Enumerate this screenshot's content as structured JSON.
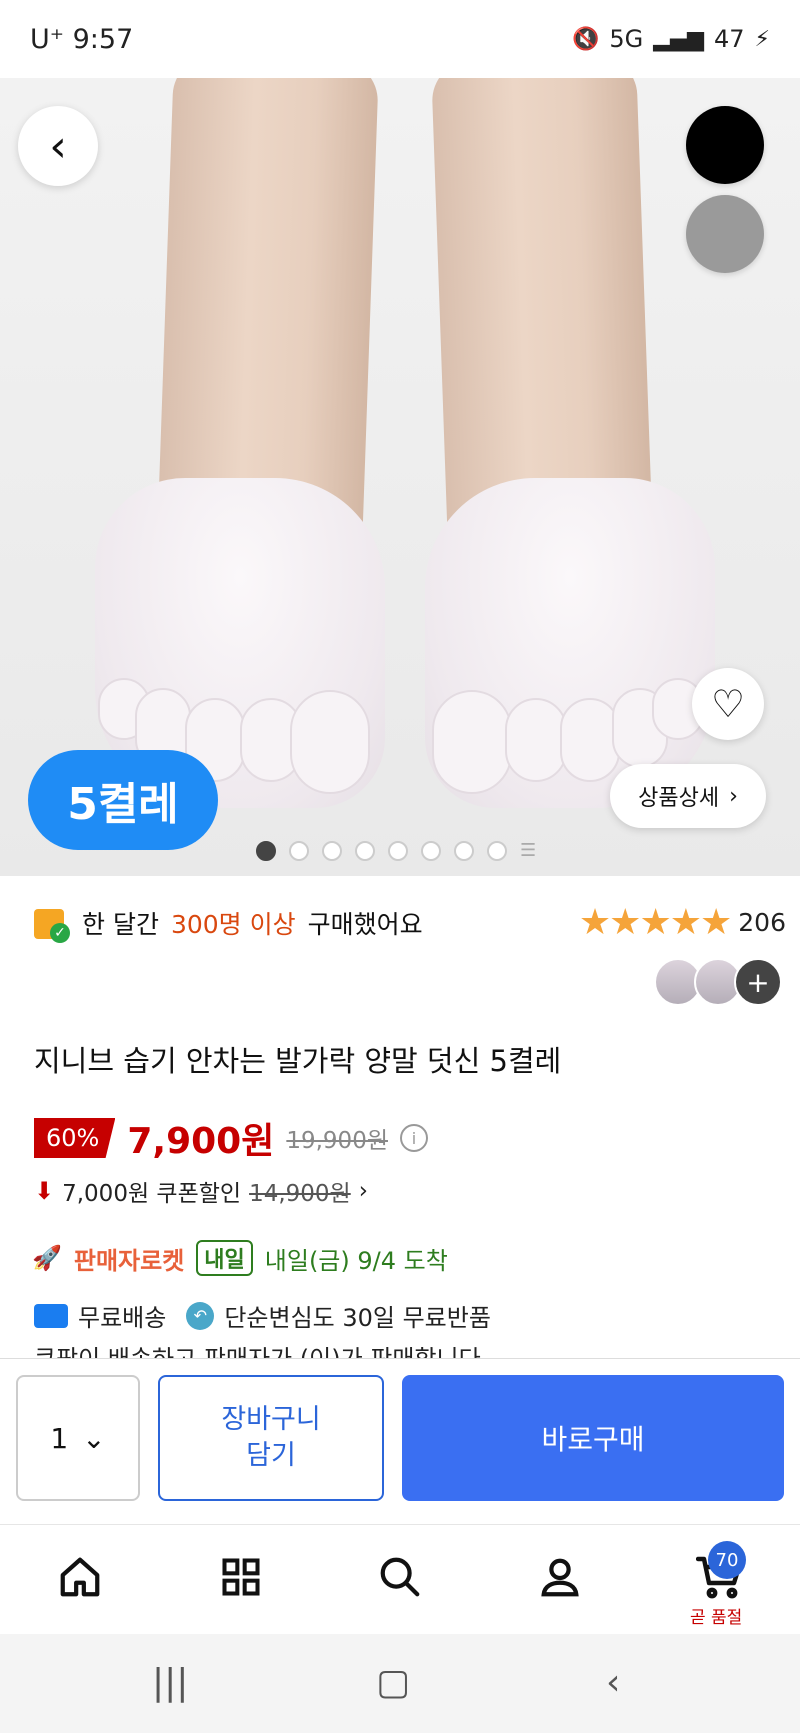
{
  "status_bar": {
    "carrier": "U⁺",
    "time": "9:57",
    "network": "5G",
    "battery": "47"
  },
  "hero": {
    "pack_label": "5켤레",
    "detail_label": "상품상세",
    "image_count": 8,
    "current_image": 1,
    "color_options": [
      {
        "name": "black",
        "color": "#000000"
      },
      {
        "name": "gray",
        "color": "#9a9a9a"
      }
    ]
  },
  "social_proof": {
    "prefix": "한 달간",
    "highlight": "300명 이상",
    "suffix": "구매했어요"
  },
  "rating": {
    "stars": 5,
    "count": "206"
  },
  "product": {
    "title": "지니브 습기 안차는 발가락 양말 덧신 5켤레"
  },
  "price": {
    "discount": "60%",
    "sale": "7,900원",
    "original": "19,900원",
    "coupon_text": "7,000원 쿠폰할인",
    "coupon_original": "14,900원"
  },
  "delivery": {
    "rocket_label": "판매자로켓",
    "tomorrow_badge": "내일",
    "arrival": "내일(금) 9/4 도착",
    "free_shipping": "무료배송",
    "free_return": "단순변심도 30일 무료반품",
    "cut_line": "쿠팡이 배송하고 판매자가 (이)가 판매합니다"
  },
  "purchase": {
    "quantity": "1",
    "cart_line1": "장바구니",
    "cart_line2": "담기",
    "buy_now": "바로구매"
  },
  "bottom_nav": {
    "cart_count": "70",
    "cart_caption": "곧 품절"
  },
  "colors": {
    "accent_blue": "#3a6ff2",
    "sale_red": "#c60000",
    "badge_blue": "#1f8cf5",
    "star": "#f5a43a"
  }
}
